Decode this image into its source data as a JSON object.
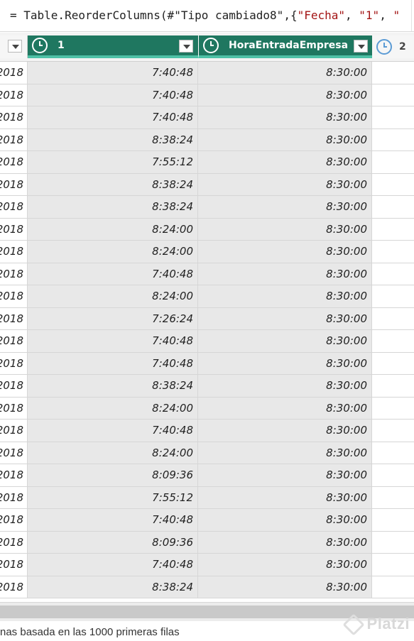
{
  "formula": {
    "prefix": "= Table.ReorderColumns(#\"Tipo cambiado8\",{",
    "arg1": "\"Fecha\"",
    "sep1": ", ",
    "arg2": "\"1\"",
    "sep2": ", ",
    "arg3": "\""
  },
  "columns": [
    {
      "label": "",
      "type_icon": "none"
    },
    {
      "label": "1",
      "type_icon": "clock-icon"
    },
    {
      "label": "HoraEntradaEmpresa",
      "type_icon": "clock-icon"
    },
    {
      "label": "2",
      "type_icon": "clock-icon"
    }
  ],
  "rows": [
    {
      "fecha": "2018",
      "c1": "7:40:48",
      "c2": "8:30:00"
    },
    {
      "fecha": "2018",
      "c1": "7:40:48",
      "c2": "8:30:00"
    },
    {
      "fecha": "2018",
      "c1": "7:40:48",
      "c2": "8:30:00"
    },
    {
      "fecha": "2018",
      "c1": "8:38:24",
      "c2": "8:30:00"
    },
    {
      "fecha": "2018",
      "c1": "7:55:12",
      "c2": "8:30:00"
    },
    {
      "fecha": "2018",
      "c1": "8:38:24",
      "c2": "8:30:00"
    },
    {
      "fecha": "2018",
      "c1": "8:38:24",
      "c2": "8:30:00"
    },
    {
      "fecha": "2018",
      "c1": "8:24:00",
      "c2": "8:30:00"
    },
    {
      "fecha": "2018",
      "c1": "8:24:00",
      "c2": "8:30:00"
    },
    {
      "fecha": "2018",
      "c1": "7:40:48",
      "c2": "8:30:00"
    },
    {
      "fecha": "2018",
      "c1": "8:24:00",
      "c2": "8:30:00"
    },
    {
      "fecha": "2018",
      "c1": "7:26:24",
      "c2": "8:30:00"
    },
    {
      "fecha": "2018",
      "c1": "7:40:48",
      "c2": "8:30:00"
    },
    {
      "fecha": "2018",
      "c1": "7:40:48",
      "c2": "8:30:00"
    },
    {
      "fecha": "2018",
      "c1": "8:38:24",
      "c2": "8:30:00"
    },
    {
      "fecha": "2018",
      "c1": "8:24:00",
      "c2": "8:30:00"
    },
    {
      "fecha": "2018",
      "c1": "7:40:48",
      "c2": "8:30:00"
    },
    {
      "fecha": "2018",
      "c1": "8:24:00",
      "c2": "8:30:00"
    },
    {
      "fecha": "2018",
      "c1": "8:09:36",
      "c2": "8:30:00"
    },
    {
      "fecha": "2018",
      "c1": "7:55:12",
      "c2": "8:30:00"
    },
    {
      "fecha": "2018",
      "c1": "7:40:48",
      "c2": "8:30:00"
    },
    {
      "fecha": "2018",
      "c1": "8:09:36",
      "c2": "8:30:00"
    },
    {
      "fecha": "2018",
      "c1": "7:40:48",
      "c2": "8:30:00"
    },
    {
      "fecha": "2018",
      "c1": "8:38:24",
      "c2": "8:30:00"
    }
  ],
  "status": {
    "text": "nas basada en las 1000 primeras filas"
  },
  "watermark": {
    "text": "Platzi"
  },
  "colors": {
    "selected_header": "#1f7760",
    "selected_header_underline": "#4ec1a6",
    "selected_cell": "#e8e8e8",
    "string_literal": "#a31515"
  }
}
